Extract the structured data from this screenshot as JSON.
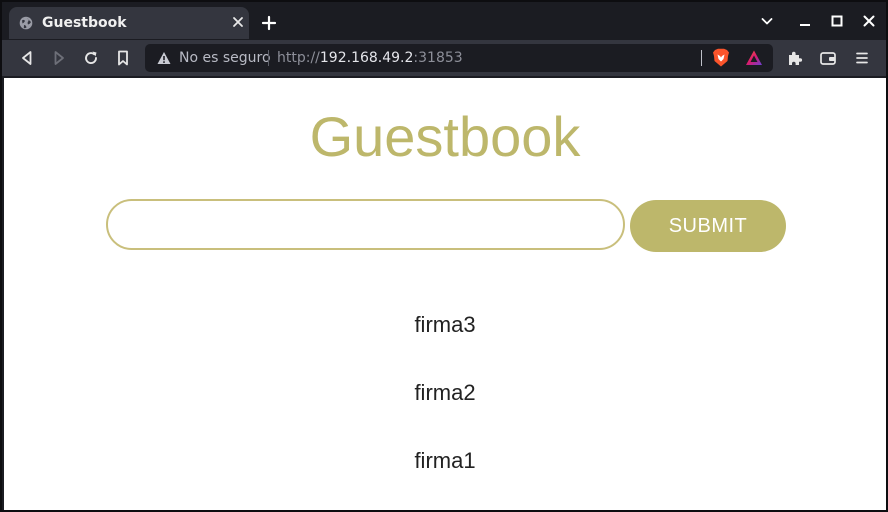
{
  "browser": {
    "tab": {
      "title": "Guestbook"
    },
    "address": {
      "security_label": "No es seguro",
      "scheme": "http://",
      "host": "192.168.49.2",
      "port": ":31853"
    },
    "icons": {
      "tab_favicon": "globe-icon",
      "tab_close": "close-icon",
      "new_tab": "plus-icon",
      "tab_list": "chevron-down-icon",
      "minimize": "minimize-icon",
      "maximize": "maximize-icon",
      "close_window": "close-icon",
      "back": "back-icon",
      "forward": "forward-icon",
      "reload": "reload-icon",
      "bookmark": "bookmark-icon",
      "warning": "warning-icon",
      "brave_shields": "brave-lion-icon",
      "brave_rewards": "rewards-triangle-icon",
      "extensions": "puzzle-icon",
      "wallet": "wallet-icon",
      "menu": "hamburger-icon"
    }
  },
  "page": {
    "title": "Guestbook",
    "input": {
      "value": "",
      "placeholder": ""
    },
    "submit_label": "SUBMIT",
    "entries": [
      "firma3",
      "firma2",
      "firma1"
    ]
  },
  "colors": {
    "accent": "#bdb76b",
    "browser_chrome": "#34363f",
    "browser_frame": "#1b1c22",
    "page_background": "#ffffff"
  }
}
